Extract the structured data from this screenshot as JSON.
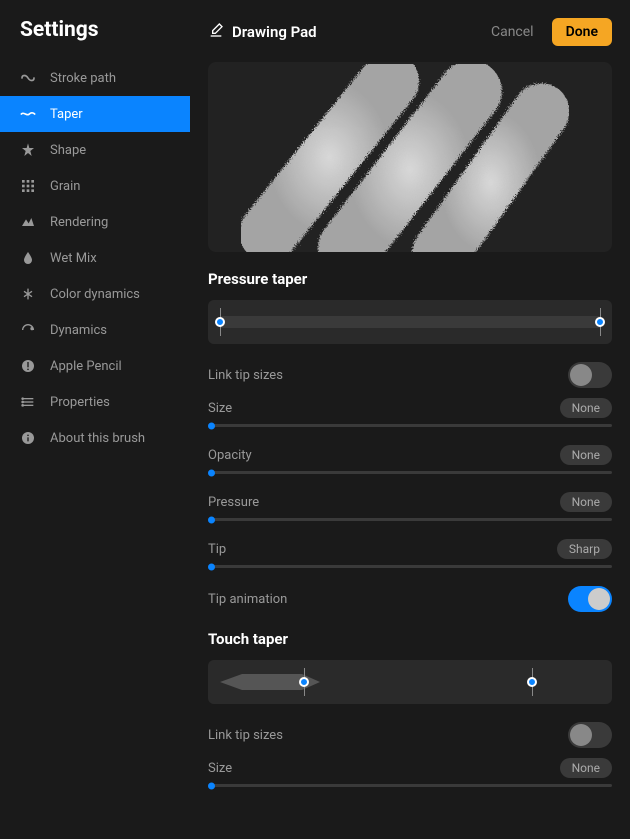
{
  "sidebar": {
    "title": "Settings",
    "items": [
      {
        "label": "Stroke path"
      },
      {
        "label": "Taper"
      },
      {
        "label": "Shape"
      },
      {
        "label": "Grain"
      },
      {
        "label": "Rendering"
      },
      {
        "label": "Wet Mix"
      },
      {
        "label": "Color dynamics"
      },
      {
        "label": "Dynamics"
      },
      {
        "label": "Apple Pencil"
      },
      {
        "label": "Properties"
      },
      {
        "label": "About this brush"
      }
    ],
    "active_index": 1
  },
  "header": {
    "title": "Drawing Pad",
    "cancel": "Cancel",
    "done": "Done"
  },
  "pressure_taper": {
    "title": "Pressure taper",
    "range": {
      "start": 0,
      "end": 100
    },
    "link_tip_sizes": {
      "label": "Link tip sizes",
      "on": false
    },
    "size": {
      "label": "Size",
      "value_label": "None",
      "pos": 0
    },
    "opacity": {
      "label": "Opacity",
      "value_label": "None",
      "pos": 0
    },
    "pressure": {
      "label": "Pressure",
      "value_label": "None",
      "pos": 0
    },
    "tip": {
      "label": "Tip",
      "value_label": "Sharp",
      "pos": 0
    },
    "tip_animation": {
      "label": "Tip animation",
      "on": true
    }
  },
  "touch_taper": {
    "title": "Touch taper",
    "range": {
      "start": 22,
      "end": 82
    },
    "link_tip_sizes": {
      "label": "Link tip sizes",
      "on": false
    },
    "size": {
      "label": "Size",
      "value_label": "None",
      "pos": 0
    }
  },
  "colors": {
    "accent": "#0a84ff",
    "done_button": "#f5a623"
  }
}
